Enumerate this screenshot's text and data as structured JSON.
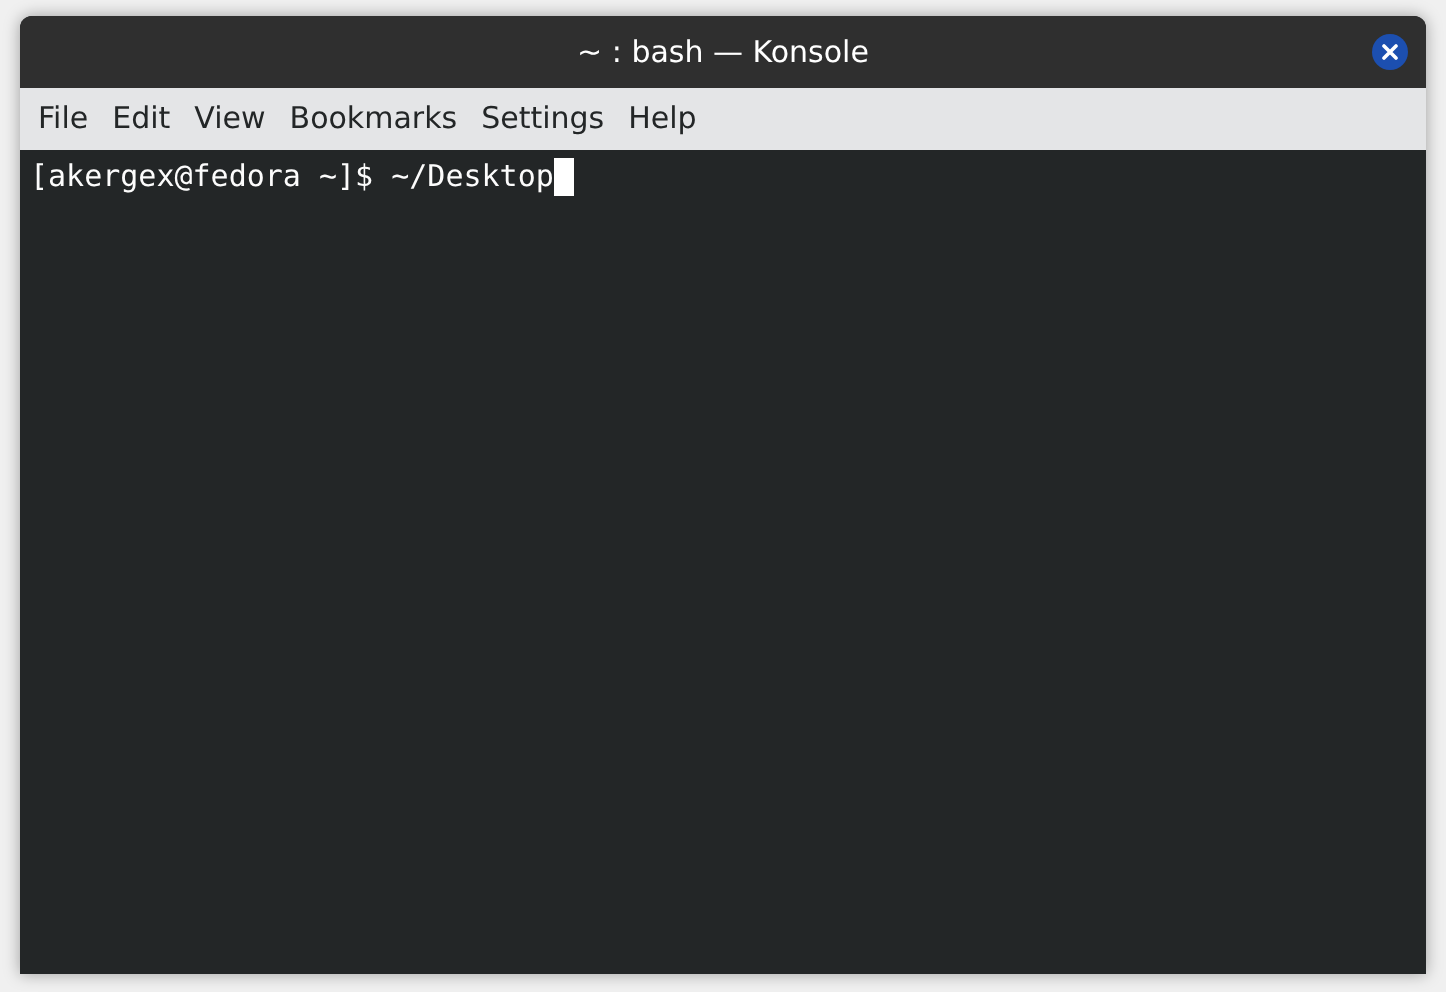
{
  "window": {
    "title": "~ : bash — Konsole"
  },
  "menu": [
    "File",
    "Edit",
    "View",
    "Bookmarks",
    "Settings",
    "Help"
  ],
  "terminal": {
    "lines": [
      "[akergex@fedora ~]$ ~/Desktop"
    ],
    "cursor": true
  }
}
